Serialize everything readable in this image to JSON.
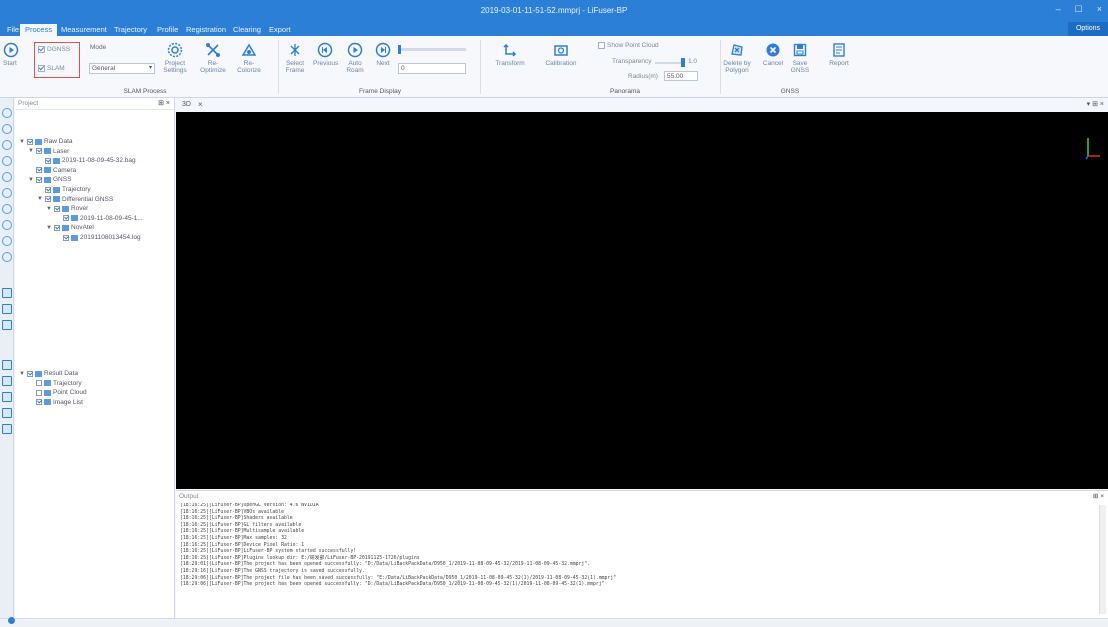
{
  "window": {
    "title": "2019-03-01-11-51-52.mmprj - LiFuser-BP",
    "min": "–",
    "max": "☐",
    "close": "×"
  },
  "menu": {
    "tabs": [
      "File",
      "Process",
      "Measurement",
      "Trajectory",
      "Profile",
      "Registration",
      "Clearing",
      "Export"
    ],
    "active": "Process",
    "options": "Options"
  },
  "ribbon": {
    "start": "Start",
    "dgnss": "DGNSS",
    "slam": "SLAM",
    "mode_label": "Mode",
    "mode_value": "General",
    "project_settings": "Project Settings",
    "re_optimize": "Re-Optimize",
    "re_colorize": "Re-Colorize",
    "slam_process": "SLAM Process",
    "select_frame": "Select Frame",
    "previous": "Previous",
    "auto_roam": "Auto Roam",
    "next": "Next",
    "frame_input": "0",
    "frame_display": "Frame Display",
    "transform": "Transform",
    "calibration": "Calibration",
    "show_point_cloud": "Show Point Cloud",
    "transparency": "Transparency",
    "transparency_value": "1.0",
    "radius": "Radius(m)",
    "radius_value": "55.00",
    "panorama": "Panorama",
    "delete_by_polygon": "Delete by Polygon",
    "cancel": "Cancel",
    "save_gnss": "Save GNSS",
    "report": "Report",
    "gnss": "GNSS"
  },
  "project": {
    "header": "Project",
    "tree": [
      {
        "label": "Raw Data",
        "level": 0,
        "checked": true,
        "twisty": "▼"
      },
      {
        "label": "Laser",
        "level": 1,
        "checked": true,
        "twisty": "▼"
      },
      {
        "label": "2019-11-08-09-45-32.bag",
        "level": 2,
        "checked": true,
        "twisty": ""
      },
      {
        "label": "Camera",
        "level": 1,
        "checked": true,
        "twisty": ""
      },
      {
        "label": "GNSS",
        "level": 1,
        "checked": true,
        "twisty": "▼"
      },
      {
        "label": "Trajectory",
        "level": 2,
        "checked": true,
        "twisty": ""
      },
      {
        "label": "Differential GNSS",
        "level": 2,
        "checked": true,
        "twisty": "▼"
      },
      {
        "label": "Rover",
        "level": 3,
        "checked": true,
        "twisty": "▼"
      },
      {
        "label": "2019-11-08-09-45-1...",
        "level": 4,
        "checked": true,
        "twisty": ""
      },
      {
        "label": "NovAtel",
        "level": 3,
        "checked": true,
        "twisty": "▼"
      },
      {
        "label": "20191108013454.log",
        "level": 4,
        "checked": true,
        "twisty": ""
      }
    ],
    "result_tree": [
      {
        "label": "Result Data",
        "level": 0,
        "checked": true,
        "twisty": "▼"
      },
      {
        "label": "Trajectory",
        "level": 1,
        "checked": false,
        "twisty": ""
      },
      {
        "label": "Point Cloud",
        "level": 1,
        "checked": false,
        "twisty": ""
      },
      {
        "label": "Image List",
        "level": 1,
        "checked": true,
        "twisty": ""
      }
    ]
  },
  "view": {
    "tab": "3D",
    "tab_close": "×"
  },
  "output": {
    "header": "Output",
    "lines": [
      "[18:16:25][LiFuser-BP]OpenGL Version: 4.6 NVIDIA",
      "[18:16:25][LiFuser-BP]VBOs available",
      "[18:16:25][LiFuser-BP]Shaders available",
      "[18:16:25][LiFuser-BP]GL filters available",
      "[18:16:25][LiFuser-BP]Multisample available",
      "[18:16:25][LiFuser-BP]Max samples: 32",
      "[18:16:25][LiFuser-BP]Device Pixel Ratio: 1",
      "[18:16:25][LiFuser-BP]LiFuser-BP system started successfully!",
      "[18:16:25][LiFuser-BP]Plugins lookup dir: E:/研发部/LiFuser-BP-20191125-1726/plugins",
      "[18:29:01][LiFuser-BP]The project has been opened successfully: \"D:/Data/LiBackPackData/D950_1/2019-11-08-09-45-32/2019-11-08-09-45-32.mmprj\".",
      "[18:29:16][LiFuser-BP]The GNSS trajectory is saved successfully.",
      "[18:29:06][LiFuser-BP]The project file has been saved successfully: \"E:/Data/LiBackPackData/D950_1/2019-11-08-09-45-32(1)/2019-11-08-09-45-32(1).mmprj\"",
      "[18:29:06][LiFuser-BP]The project has been opened successfully: \"D:/Data/LiBackPackData/D950_1/2019-11-08-09-45-32(1)/2019-11-08-09-45-32(1).mmprj\""
    ]
  }
}
